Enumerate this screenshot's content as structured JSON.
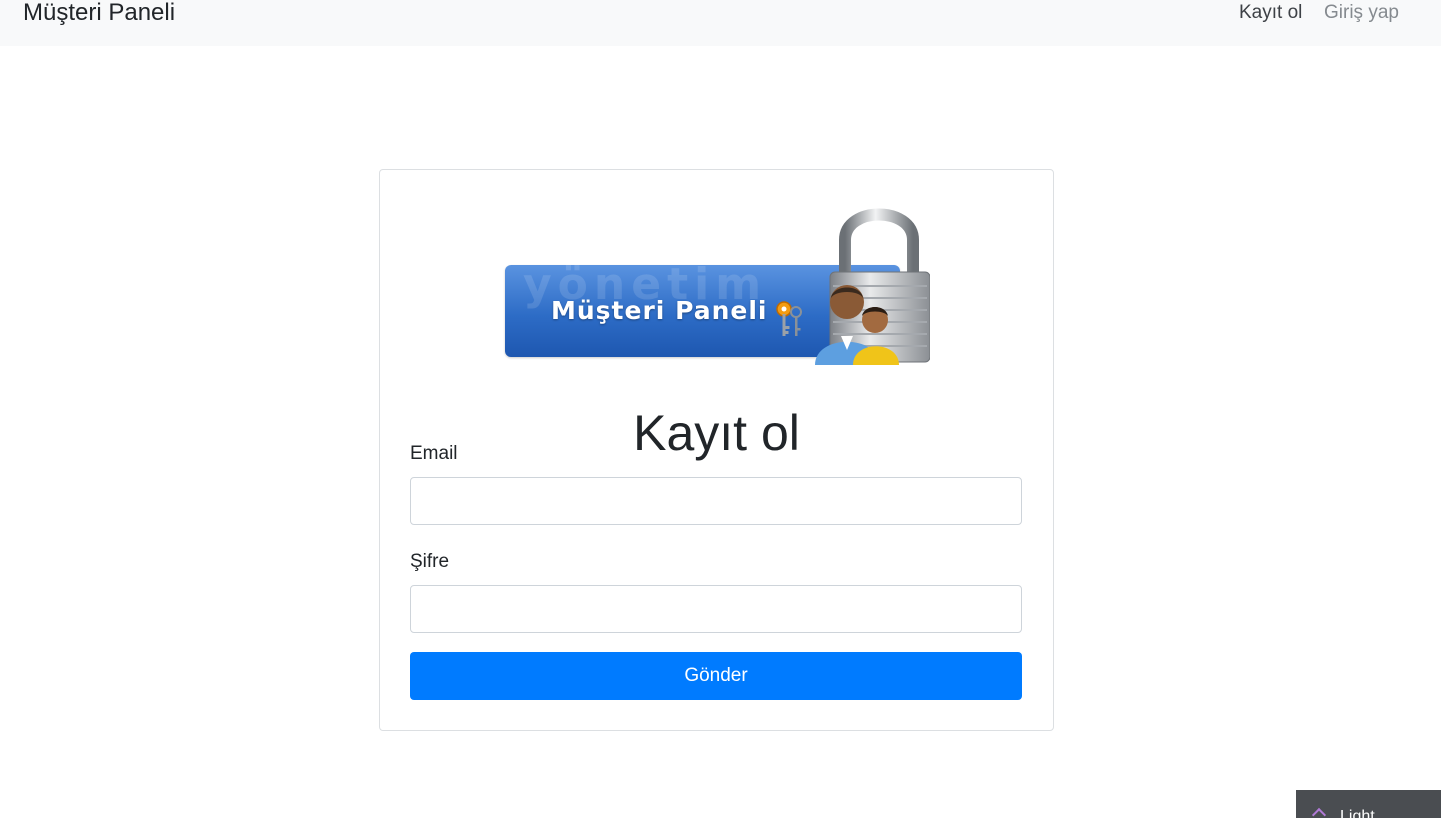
{
  "navbar": {
    "brand": "Müşteri Paneli",
    "links": [
      {
        "label": "Kayıt ol",
        "state": "active"
      },
      {
        "label": "Giriş yap",
        "state": "muted"
      }
    ]
  },
  "logo": {
    "text": "Müşteri Paneli",
    "watermark": "yönetim",
    "icons": [
      "lock-icon",
      "keys-icon",
      "users-icon"
    ]
  },
  "form": {
    "title": "Kayıt ol",
    "email_label": "Email",
    "email_value": "",
    "password_label": "Şifre",
    "password_value": "",
    "submit_label": "Gönder"
  },
  "corner_widget": {
    "text": "Light"
  },
  "colors": {
    "navbar_bg": "#f8f9fa",
    "primary": "#007bff",
    "card_border": "#dcdfe2",
    "banner_blue": "#2d6cc6"
  }
}
